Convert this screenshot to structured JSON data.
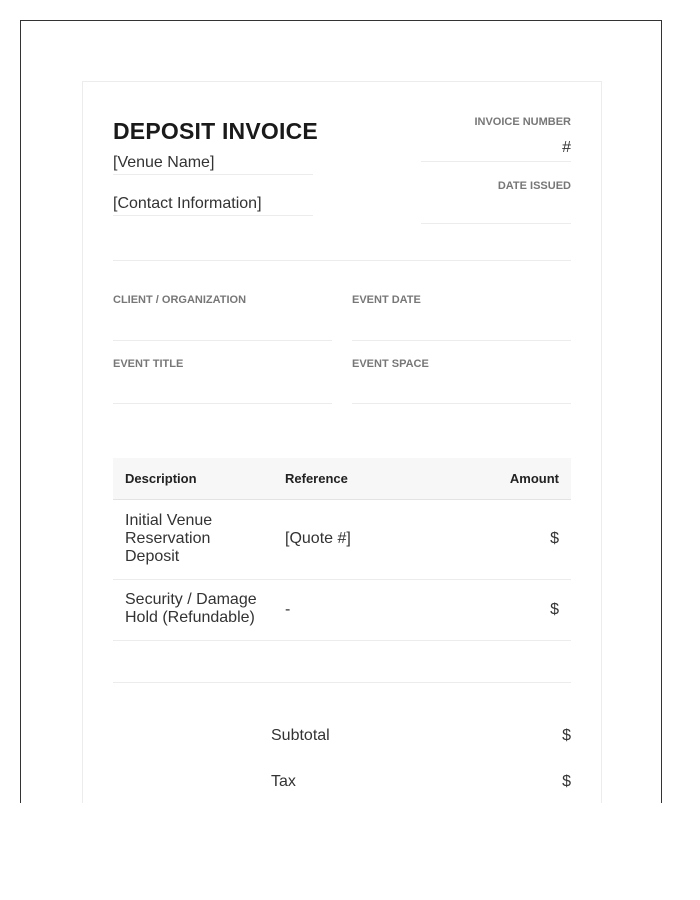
{
  "header": {
    "title": "DEPOSIT INVOICE",
    "venue_name": "[Venue Name]",
    "contact_info": "[Contact Information]",
    "invoice_number_label": "INVOICE NUMBER",
    "invoice_number_value": "#",
    "date_issued_label": "DATE ISSUED"
  },
  "fields": {
    "client_label": "CLIENT / ORGANIZATION",
    "event_date_label": "EVENT DATE",
    "event_title_label": "EVENT TITLE",
    "event_space_label": "EVENT SPACE"
  },
  "table": {
    "headers": [
      "Description",
      "Reference",
      "Amount"
    ],
    "rows": [
      {
        "description": "Initial Venue Reservation Deposit",
        "reference": "[Quote #]",
        "amount": "$"
      },
      {
        "description": "Security / Damage Hold (Refundable)",
        "reference": "-",
        "amount": "$"
      }
    ]
  },
  "totals": {
    "subtotal_label": "Subtotal",
    "subtotal_value": "$",
    "tax_label": "Tax",
    "tax_value": "$"
  }
}
